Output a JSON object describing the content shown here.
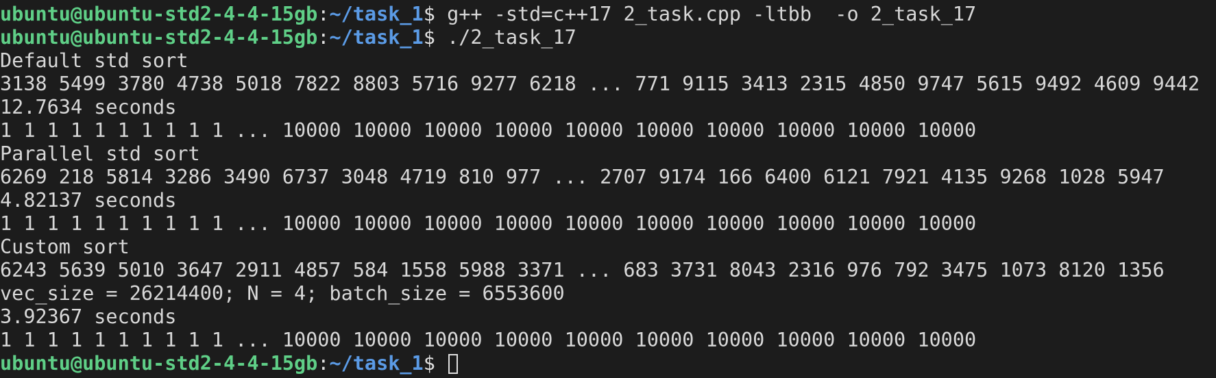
{
  "prompt": {
    "user_host": "ubuntu@ubuntu-std2-4-4-15gb",
    "separator": ":",
    "path": "~/task_1",
    "symbol": "$ "
  },
  "commands": [
    "g++ -std=c++17 2_task.cpp -ltbb  -o 2_task_17",
    "./2_task_17"
  ],
  "output": [
    "Default std sort",
    "3138 5499 3780 4738 5018 7822 8803 5716 9277 6218 ... 771 9115 3413 2315 4850 9747 5615 9492 4609 9442",
    "12.7634 seconds",
    "1 1 1 1 1 1 1 1 1 1 ... 10000 10000 10000 10000 10000 10000 10000 10000 10000 10000",
    "Parallel std sort",
    "6269 218 5814 3286 3490 6737 3048 4719 810 977 ... 2707 9174 166 6400 6121 7921 4135 9268 1028 5947",
    "4.82137 seconds",
    "1 1 1 1 1 1 1 1 1 1 ... 10000 10000 10000 10000 10000 10000 10000 10000 10000 10000",
    "Custom sort",
    "6243 5639 5010 3647 2911 4857 584 1558 5988 3371 ... 683 3731 8043 2316 976 792 3475 1073 8120 1356",
    "vec_size = 26214400; N = 4; batch_size = 6553600",
    "3.92367 seconds",
    "1 1 1 1 1 1 1 1 1 1 ... 10000 10000 10000 10000 10000 10000 10000 10000 10000 10000"
  ],
  "colors": {
    "background": "#1c1c1c",
    "text": "#d8d8d8",
    "user_host": "#5fcf87",
    "path": "#5b9be6"
  }
}
